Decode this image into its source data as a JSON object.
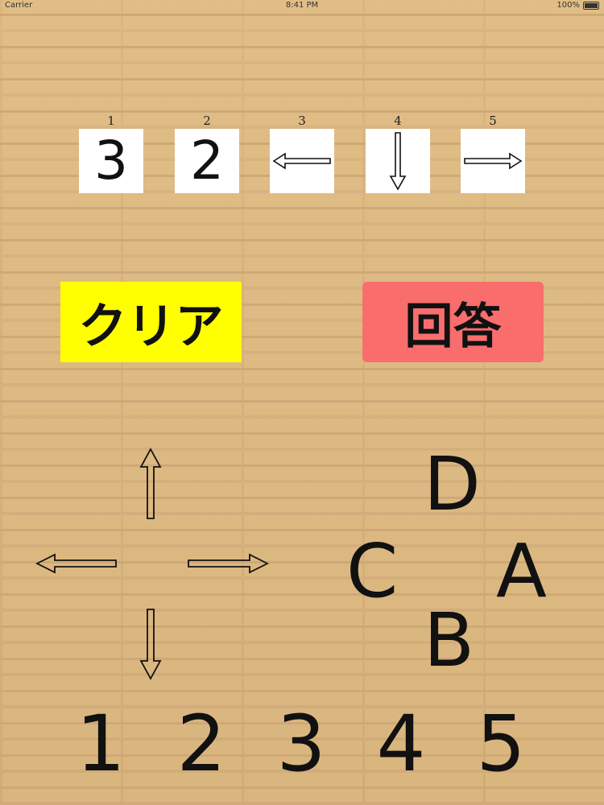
{
  "status_bar": {
    "carrier": "Carrier",
    "time": "8:41 PM",
    "battery": "100%"
  },
  "slots": [
    {
      "label": "1",
      "value": "3",
      "arrow": ""
    },
    {
      "label": "2",
      "value": "2",
      "arrow": ""
    },
    {
      "label": "3",
      "value": "",
      "arrow": "left"
    },
    {
      "label": "4",
      "value": "",
      "arrow": "down"
    },
    {
      "label": "5",
      "value": "",
      "arrow": "right"
    }
  ],
  "buttons": {
    "clear": "クリア",
    "answer": "回答"
  },
  "letters": {
    "a": "A",
    "b": "B",
    "c": "C",
    "d": "D"
  },
  "numbers": [
    "1",
    "2",
    "3",
    "4",
    "5"
  ],
  "colors": {
    "clear_bg": "#ffff00",
    "answer_bg": "#f96d6d",
    "slot_bg": "#ffffff"
  }
}
